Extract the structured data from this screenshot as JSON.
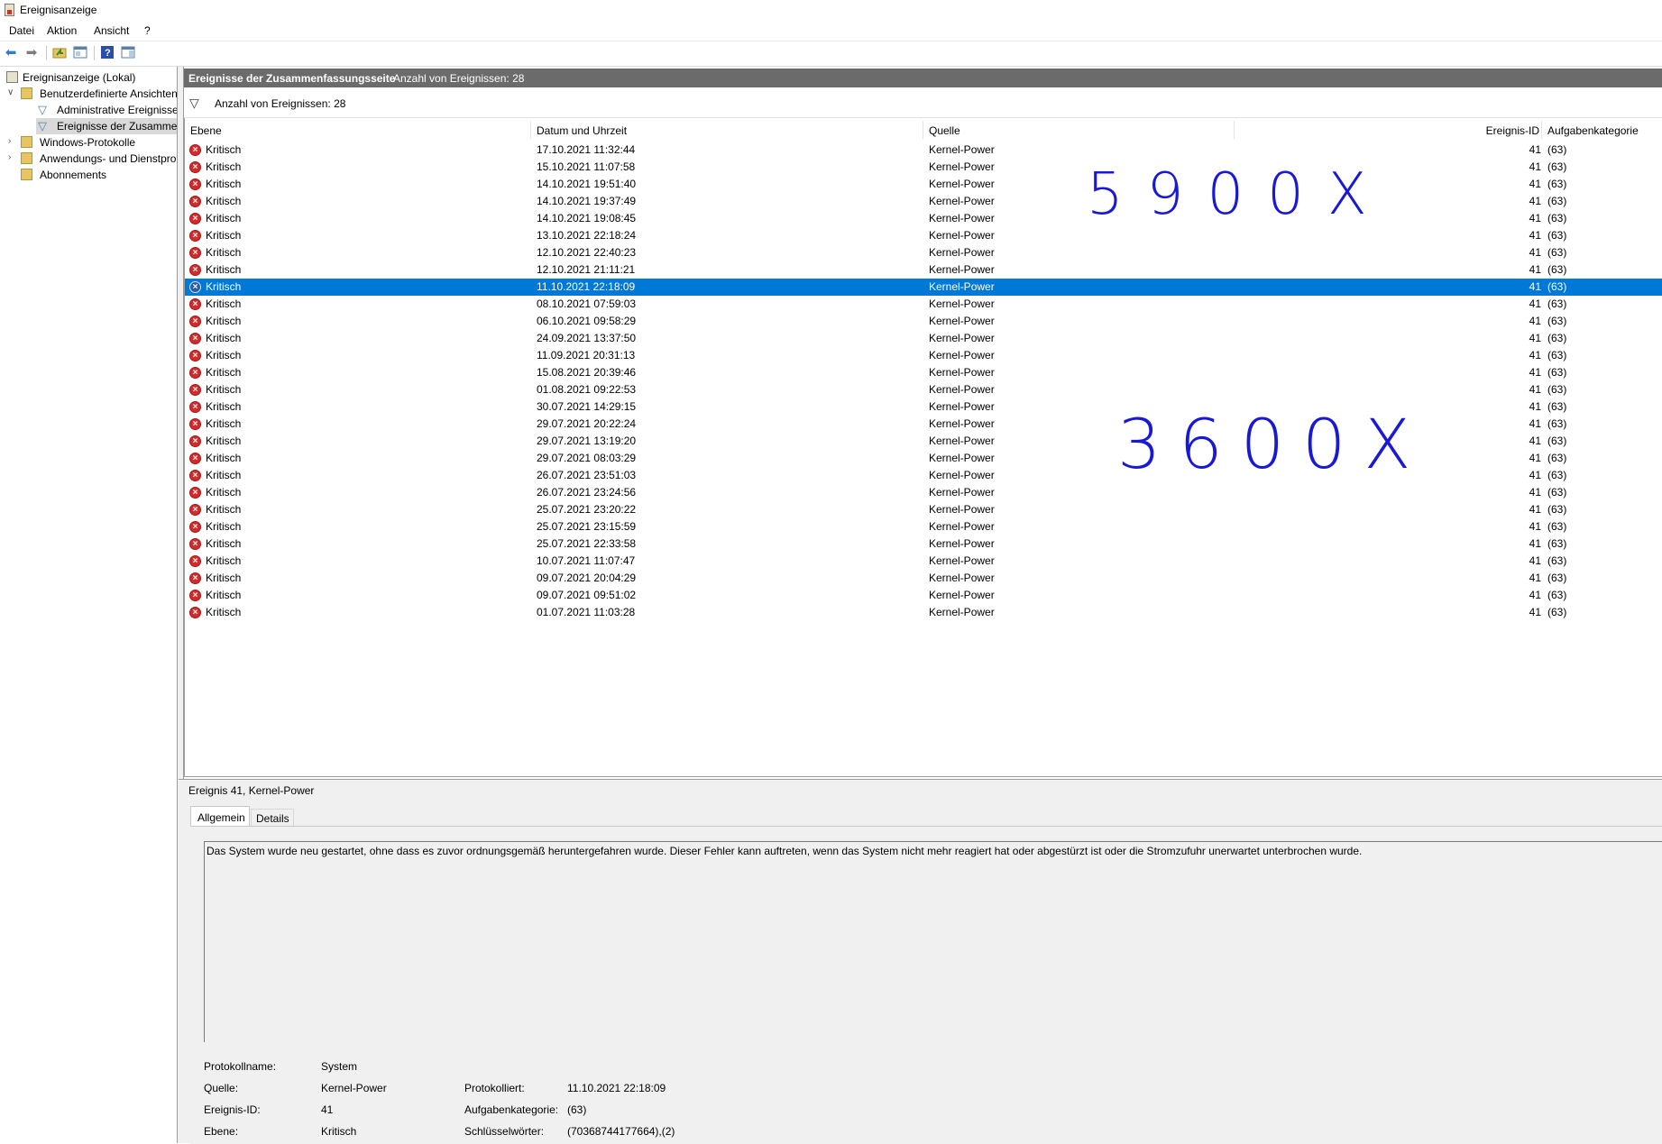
{
  "window": {
    "title": "Ereignisanzeige"
  },
  "menu": {
    "items": [
      "Datei",
      "Aktion",
      "Ansicht",
      "?"
    ]
  },
  "toolbar": {
    "icons": [
      "back-arrow-icon",
      "forward-arrow-icon",
      "folder-up-icon",
      "properties-icon",
      "help-icon",
      "action-pane-icon"
    ]
  },
  "tree": {
    "root": "Ereignisanzeige (Lokal)",
    "custom_views": "Benutzerdefinierte Ansichten",
    "admin_events": "Administrative Ereignisse",
    "summary_events": "Ereignisse der Zusammen",
    "windows_logs": "Windows-Protokolle",
    "app_service_logs": "Anwendungs- und Dienstpro",
    "subscriptions": "Abonnements"
  },
  "header": {
    "title": "Ereignisse der Zusammenfassungsseite",
    "count": "Anzahl von Ereignissen: 28"
  },
  "filter": {
    "text": "Anzahl von Ereignissen: 28"
  },
  "columns": {
    "level": "Ebene",
    "datetime": "Datum und Uhrzeit",
    "source": "Quelle",
    "event_id": "Ereignis-ID",
    "task": "Aufgabenkategorie"
  },
  "rows": [
    {
      "level": "Kritisch",
      "datetime": "17.10.2021 11:32:44",
      "source": "Kernel-Power",
      "id": "41",
      "task": "(63)"
    },
    {
      "level": "Kritisch",
      "datetime": "15.10.2021 11:07:58",
      "source": "Kernel-Power",
      "id": "41",
      "task": "(63)"
    },
    {
      "level": "Kritisch",
      "datetime": "14.10.2021 19:51:40",
      "source": "Kernel-Power",
      "id": "41",
      "task": "(63)"
    },
    {
      "level": "Kritisch",
      "datetime": "14.10.2021 19:37:49",
      "source": "Kernel-Power",
      "id": "41",
      "task": "(63)"
    },
    {
      "level": "Kritisch",
      "datetime": "14.10.2021 19:08:45",
      "source": "Kernel-Power",
      "id": "41",
      "task": "(63)"
    },
    {
      "level": "Kritisch",
      "datetime": "13.10.2021 22:18:24",
      "source": "Kernel-Power",
      "id": "41",
      "task": "(63)"
    },
    {
      "level": "Kritisch",
      "datetime": "12.10.2021 22:40:23",
      "source": "Kernel-Power",
      "id": "41",
      "task": "(63)"
    },
    {
      "level": "Kritisch",
      "datetime": "12.10.2021 21:11:21",
      "source": "Kernel-Power",
      "id": "41",
      "task": "(63)"
    },
    {
      "level": "Kritisch",
      "datetime": "11.10.2021 22:18:09",
      "source": "Kernel-Power",
      "id": "41",
      "task": "(63)",
      "selected": true
    },
    {
      "level": "Kritisch",
      "datetime": "08.10.2021 07:59:03",
      "source": "Kernel-Power",
      "id": "41",
      "task": "(63)"
    },
    {
      "level": "Kritisch",
      "datetime": "06.10.2021 09:58:29",
      "source": "Kernel-Power",
      "id": "41",
      "task": "(63)"
    },
    {
      "level": "Kritisch",
      "datetime": "24.09.2021 13:37:50",
      "source": "Kernel-Power",
      "id": "41",
      "task": "(63)"
    },
    {
      "level": "Kritisch",
      "datetime": "11.09.2021 20:31:13",
      "source": "Kernel-Power",
      "id": "41",
      "task": "(63)"
    },
    {
      "level": "Kritisch",
      "datetime": "15.08.2021 20:39:46",
      "source": "Kernel-Power",
      "id": "41",
      "task": "(63)"
    },
    {
      "level": "Kritisch",
      "datetime": "01.08.2021 09:22:53",
      "source": "Kernel-Power",
      "id": "41",
      "task": "(63)"
    },
    {
      "level": "Kritisch",
      "datetime": "30.07.2021 14:29:15",
      "source": "Kernel-Power",
      "id": "41",
      "task": "(63)"
    },
    {
      "level": "Kritisch",
      "datetime": "29.07.2021 20:22:24",
      "source": "Kernel-Power",
      "id": "41",
      "task": "(63)"
    },
    {
      "level": "Kritisch",
      "datetime": "29.07.2021 13:19:20",
      "source": "Kernel-Power",
      "id": "41",
      "task": "(63)"
    },
    {
      "level": "Kritisch",
      "datetime": "29.07.2021 08:03:29",
      "source": "Kernel-Power",
      "id": "41",
      "task": "(63)"
    },
    {
      "level": "Kritisch",
      "datetime": "26.07.2021 23:51:03",
      "source": "Kernel-Power",
      "id": "41",
      "task": "(63)"
    },
    {
      "level": "Kritisch",
      "datetime": "26.07.2021 23:24:56",
      "source": "Kernel-Power",
      "id": "41",
      "task": "(63)"
    },
    {
      "level": "Kritisch",
      "datetime": "25.07.2021 23:20:22",
      "source": "Kernel-Power",
      "id": "41",
      "task": "(63)"
    },
    {
      "level": "Kritisch",
      "datetime": "25.07.2021 23:15:59",
      "source": "Kernel-Power",
      "id": "41",
      "task": "(63)"
    },
    {
      "level": "Kritisch",
      "datetime": "25.07.2021 22:33:58",
      "source": "Kernel-Power",
      "id": "41",
      "task": "(63)"
    },
    {
      "level": "Kritisch",
      "datetime": "10.07.2021 11:07:47",
      "source": "Kernel-Power",
      "id": "41",
      "task": "(63)"
    },
    {
      "level": "Kritisch",
      "datetime": "09.07.2021 20:04:29",
      "source": "Kernel-Power",
      "id": "41",
      "task": "(63)"
    },
    {
      "level": "Kritisch",
      "datetime": "09.07.2021 09:51:02",
      "source": "Kernel-Power",
      "id": "41",
      "task": "(63)"
    },
    {
      "level": "Kritisch",
      "datetime": "01.07.2021 11:03:28",
      "source": "Kernel-Power",
      "id": "41",
      "task": "(63)"
    }
  ],
  "annotations": {
    "upper": "5900X",
    "lower": "3600X"
  },
  "details": {
    "title": "Ereignis 41, Kernel-Power",
    "tab_general": "Allgemein",
    "tab_details": "Details",
    "description": "Das System wurde neu gestartet, ohne dass es zuvor ordnungsgemäß heruntergefahren wurde. Dieser Fehler kann auftreten, wenn das System nicht mehr reagiert hat oder abgestürzt ist oder die Stromzufuhr unerwartet unterbrochen wurde.",
    "log_name_label": "Protokollname:",
    "log_name": "System",
    "source_label": "Quelle:",
    "source": "Kernel-Power",
    "logged_label": "Protokolliert:",
    "logged": "11.10.2021 22:18:09",
    "event_id_label": "Ereignis-ID:",
    "event_id": "41",
    "task_label": "Aufgabenkategorie:",
    "task": "(63)",
    "level_label": "Ebene:",
    "level": "Kritisch",
    "keywords_label": "Schlüsselwörter:",
    "keywords": "(70368744177664),(2)"
  },
  "colors": {
    "selection": "#0078d7",
    "critical": "#d62a2a",
    "annotation": "#1818d8",
    "header_bg": "#6b6b6b"
  }
}
